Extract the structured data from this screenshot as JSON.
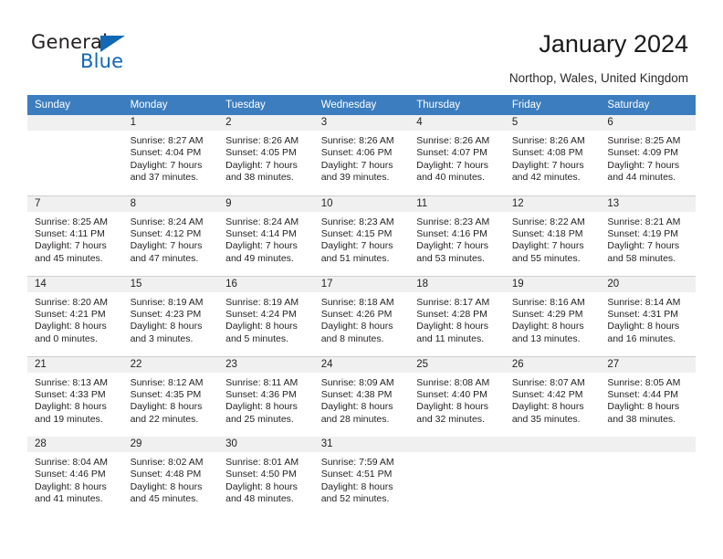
{
  "brand": {
    "name_part1": "General",
    "name_part2": "Blue"
  },
  "header": {
    "title": "January 2024",
    "location": "Northop, Wales, United Kingdom"
  },
  "colors": {
    "header_blue": "#3b7dbf",
    "brand_blue": "#1268b3",
    "daynum_band": "#f0f0f0",
    "separator": "#cfcfcf"
  },
  "weekday_headers": [
    "Sunday",
    "Monday",
    "Tuesday",
    "Wednesday",
    "Thursday",
    "Friday",
    "Saturday"
  ],
  "weeks": [
    [
      {
        "day": "",
        "sunrise": "",
        "sunset": "",
        "daylight_line1": "",
        "daylight_line2": ""
      },
      {
        "day": "1",
        "sunrise": "Sunrise: 8:27 AM",
        "sunset": "Sunset: 4:04 PM",
        "daylight_line1": "Daylight: 7 hours",
        "daylight_line2": "and 37 minutes."
      },
      {
        "day": "2",
        "sunrise": "Sunrise: 8:26 AM",
        "sunset": "Sunset: 4:05 PM",
        "daylight_line1": "Daylight: 7 hours",
        "daylight_line2": "and 38 minutes."
      },
      {
        "day": "3",
        "sunrise": "Sunrise: 8:26 AM",
        "sunset": "Sunset: 4:06 PM",
        "daylight_line1": "Daylight: 7 hours",
        "daylight_line2": "and 39 minutes."
      },
      {
        "day": "4",
        "sunrise": "Sunrise: 8:26 AM",
        "sunset": "Sunset: 4:07 PM",
        "daylight_line1": "Daylight: 7 hours",
        "daylight_line2": "and 40 minutes."
      },
      {
        "day": "5",
        "sunrise": "Sunrise: 8:26 AM",
        "sunset": "Sunset: 4:08 PM",
        "daylight_line1": "Daylight: 7 hours",
        "daylight_line2": "and 42 minutes."
      },
      {
        "day": "6",
        "sunrise": "Sunrise: 8:25 AM",
        "sunset": "Sunset: 4:09 PM",
        "daylight_line1": "Daylight: 7 hours",
        "daylight_line2": "and 44 minutes."
      }
    ],
    [
      {
        "day": "7",
        "sunrise": "Sunrise: 8:25 AM",
        "sunset": "Sunset: 4:11 PM",
        "daylight_line1": "Daylight: 7 hours",
        "daylight_line2": "and 45 minutes."
      },
      {
        "day": "8",
        "sunrise": "Sunrise: 8:24 AM",
        "sunset": "Sunset: 4:12 PM",
        "daylight_line1": "Daylight: 7 hours",
        "daylight_line2": "and 47 minutes."
      },
      {
        "day": "9",
        "sunrise": "Sunrise: 8:24 AM",
        "sunset": "Sunset: 4:14 PM",
        "daylight_line1": "Daylight: 7 hours",
        "daylight_line2": "and 49 minutes."
      },
      {
        "day": "10",
        "sunrise": "Sunrise: 8:23 AM",
        "sunset": "Sunset: 4:15 PM",
        "daylight_line1": "Daylight: 7 hours",
        "daylight_line2": "and 51 minutes."
      },
      {
        "day": "11",
        "sunrise": "Sunrise: 8:23 AM",
        "sunset": "Sunset: 4:16 PM",
        "daylight_line1": "Daylight: 7 hours",
        "daylight_line2": "and 53 minutes."
      },
      {
        "day": "12",
        "sunrise": "Sunrise: 8:22 AM",
        "sunset": "Sunset: 4:18 PM",
        "daylight_line1": "Daylight: 7 hours",
        "daylight_line2": "and 55 minutes."
      },
      {
        "day": "13",
        "sunrise": "Sunrise: 8:21 AM",
        "sunset": "Sunset: 4:19 PM",
        "daylight_line1": "Daylight: 7 hours",
        "daylight_line2": "and 58 minutes."
      }
    ],
    [
      {
        "day": "14",
        "sunrise": "Sunrise: 8:20 AM",
        "sunset": "Sunset: 4:21 PM",
        "daylight_line1": "Daylight: 8 hours",
        "daylight_line2": "and 0 minutes."
      },
      {
        "day": "15",
        "sunrise": "Sunrise: 8:19 AM",
        "sunset": "Sunset: 4:23 PM",
        "daylight_line1": "Daylight: 8 hours",
        "daylight_line2": "and 3 minutes."
      },
      {
        "day": "16",
        "sunrise": "Sunrise: 8:19 AM",
        "sunset": "Sunset: 4:24 PM",
        "daylight_line1": "Daylight: 8 hours",
        "daylight_line2": "and 5 minutes."
      },
      {
        "day": "17",
        "sunrise": "Sunrise: 8:18 AM",
        "sunset": "Sunset: 4:26 PM",
        "daylight_line1": "Daylight: 8 hours",
        "daylight_line2": "and 8 minutes."
      },
      {
        "day": "18",
        "sunrise": "Sunrise: 8:17 AM",
        "sunset": "Sunset: 4:28 PM",
        "daylight_line1": "Daylight: 8 hours",
        "daylight_line2": "and 11 minutes."
      },
      {
        "day": "19",
        "sunrise": "Sunrise: 8:16 AM",
        "sunset": "Sunset: 4:29 PM",
        "daylight_line1": "Daylight: 8 hours",
        "daylight_line2": "and 13 minutes."
      },
      {
        "day": "20",
        "sunrise": "Sunrise: 8:14 AM",
        "sunset": "Sunset: 4:31 PM",
        "daylight_line1": "Daylight: 8 hours",
        "daylight_line2": "and 16 minutes."
      }
    ],
    [
      {
        "day": "21",
        "sunrise": "Sunrise: 8:13 AM",
        "sunset": "Sunset: 4:33 PM",
        "daylight_line1": "Daylight: 8 hours",
        "daylight_line2": "and 19 minutes."
      },
      {
        "day": "22",
        "sunrise": "Sunrise: 8:12 AM",
        "sunset": "Sunset: 4:35 PM",
        "daylight_line1": "Daylight: 8 hours",
        "daylight_line2": "and 22 minutes."
      },
      {
        "day": "23",
        "sunrise": "Sunrise: 8:11 AM",
        "sunset": "Sunset: 4:36 PM",
        "daylight_line1": "Daylight: 8 hours",
        "daylight_line2": "and 25 minutes."
      },
      {
        "day": "24",
        "sunrise": "Sunrise: 8:09 AM",
        "sunset": "Sunset: 4:38 PM",
        "daylight_line1": "Daylight: 8 hours",
        "daylight_line2": "and 28 minutes."
      },
      {
        "day": "25",
        "sunrise": "Sunrise: 8:08 AM",
        "sunset": "Sunset: 4:40 PM",
        "daylight_line1": "Daylight: 8 hours",
        "daylight_line2": "and 32 minutes."
      },
      {
        "day": "26",
        "sunrise": "Sunrise: 8:07 AM",
        "sunset": "Sunset: 4:42 PM",
        "daylight_line1": "Daylight: 8 hours",
        "daylight_line2": "and 35 minutes."
      },
      {
        "day": "27",
        "sunrise": "Sunrise: 8:05 AM",
        "sunset": "Sunset: 4:44 PM",
        "daylight_line1": "Daylight: 8 hours",
        "daylight_line2": "and 38 minutes."
      }
    ],
    [
      {
        "day": "28",
        "sunrise": "Sunrise: 8:04 AM",
        "sunset": "Sunset: 4:46 PM",
        "daylight_line1": "Daylight: 8 hours",
        "daylight_line2": "and 41 minutes."
      },
      {
        "day": "29",
        "sunrise": "Sunrise: 8:02 AM",
        "sunset": "Sunset: 4:48 PM",
        "daylight_line1": "Daylight: 8 hours",
        "daylight_line2": "and 45 minutes."
      },
      {
        "day": "30",
        "sunrise": "Sunrise: 8:01 AM",
        "sunset": "Sunset: 4:50 PM",
        "daylight_line1": "Daylight: 8 hours",
        "daylight_line2": "and 48 minutes."
      },
      {
        "day": "31",
        "sunrise": "Sunrise: 7:59 AM",
        "sunset": "Sunset: 4:51 PM",
        "daylight_line1": "Daylight: 8 hours",
        "daylight_line2": "and 52 minutes."
      },
      {
        "day": "",
        "sunrise": "",
        "sunset": "",
        "daylight_line1": "",
        "daylight_line2": ""
      },
      {
        "day": "",
        "sunrise": "",
        "sunset": "",
        "daylight_line1": "",
        "daylight_line2": ""
      },
      {
        "day": "",
        "sunrise": "",
        "sunset": "",
        "daylight_line1": "",
        "daylight_line2": ""
      }
    ]
  ]
}
